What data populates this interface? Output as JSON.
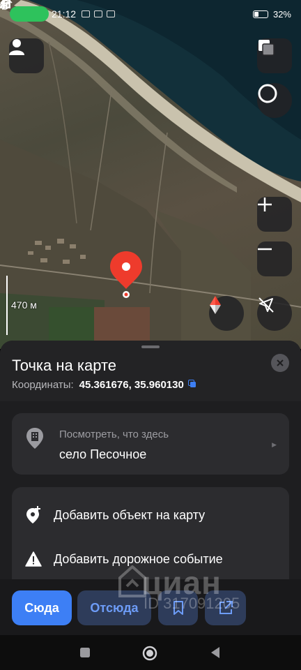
{
  "status_bar": {
    "time": "21:12",
    "battery": "32%",
    "icons": [
      "mic-icon",
      "bluetooth-icon",
      "registered-icon",
      "signal-icon",
      "wifi-icon",
      "battery-icon"
    ]
  },
  "map": {
    "scale_label": "470 м",
    "controls": [
      "profile-icon",
      "layers-icon",
      "alice-icon",
      "zoom-in-icon",
      "zoom-out-icon",
      "compass-icon",
      "location-off-icon"
    ]
  },
  "sheet": {
    "title": "Точка на карте",
    "coords_label": "Координаты:",
    "coords_value": "45.361676, 35.960130",
    "place": {
      "hint": "Посмотреть, что здесь",
      "name": "село Песочное"
    },
    "actions": [
      {
        "label": "Добавить объект на карту",
        "icon": "add-place-icon"
      },
      {
        "label": "Добавить дорожное событие",
        "icon": "warning-icon"
      }
    ]
  },
  "action_bar": {
    "here_label": "Сюда",
    "from_label": "Отсюда"
  },
  "watermark": {
    "brand": "циан",
    "id": "ID 317091205"
  },
  "colors": {
    "accent": "#3d7ff5",
    "sheet_bg": "#1e1e20",
    "pin": "#ee3b2c",
    "card_bg": "#2c2c2f"
  }
}
